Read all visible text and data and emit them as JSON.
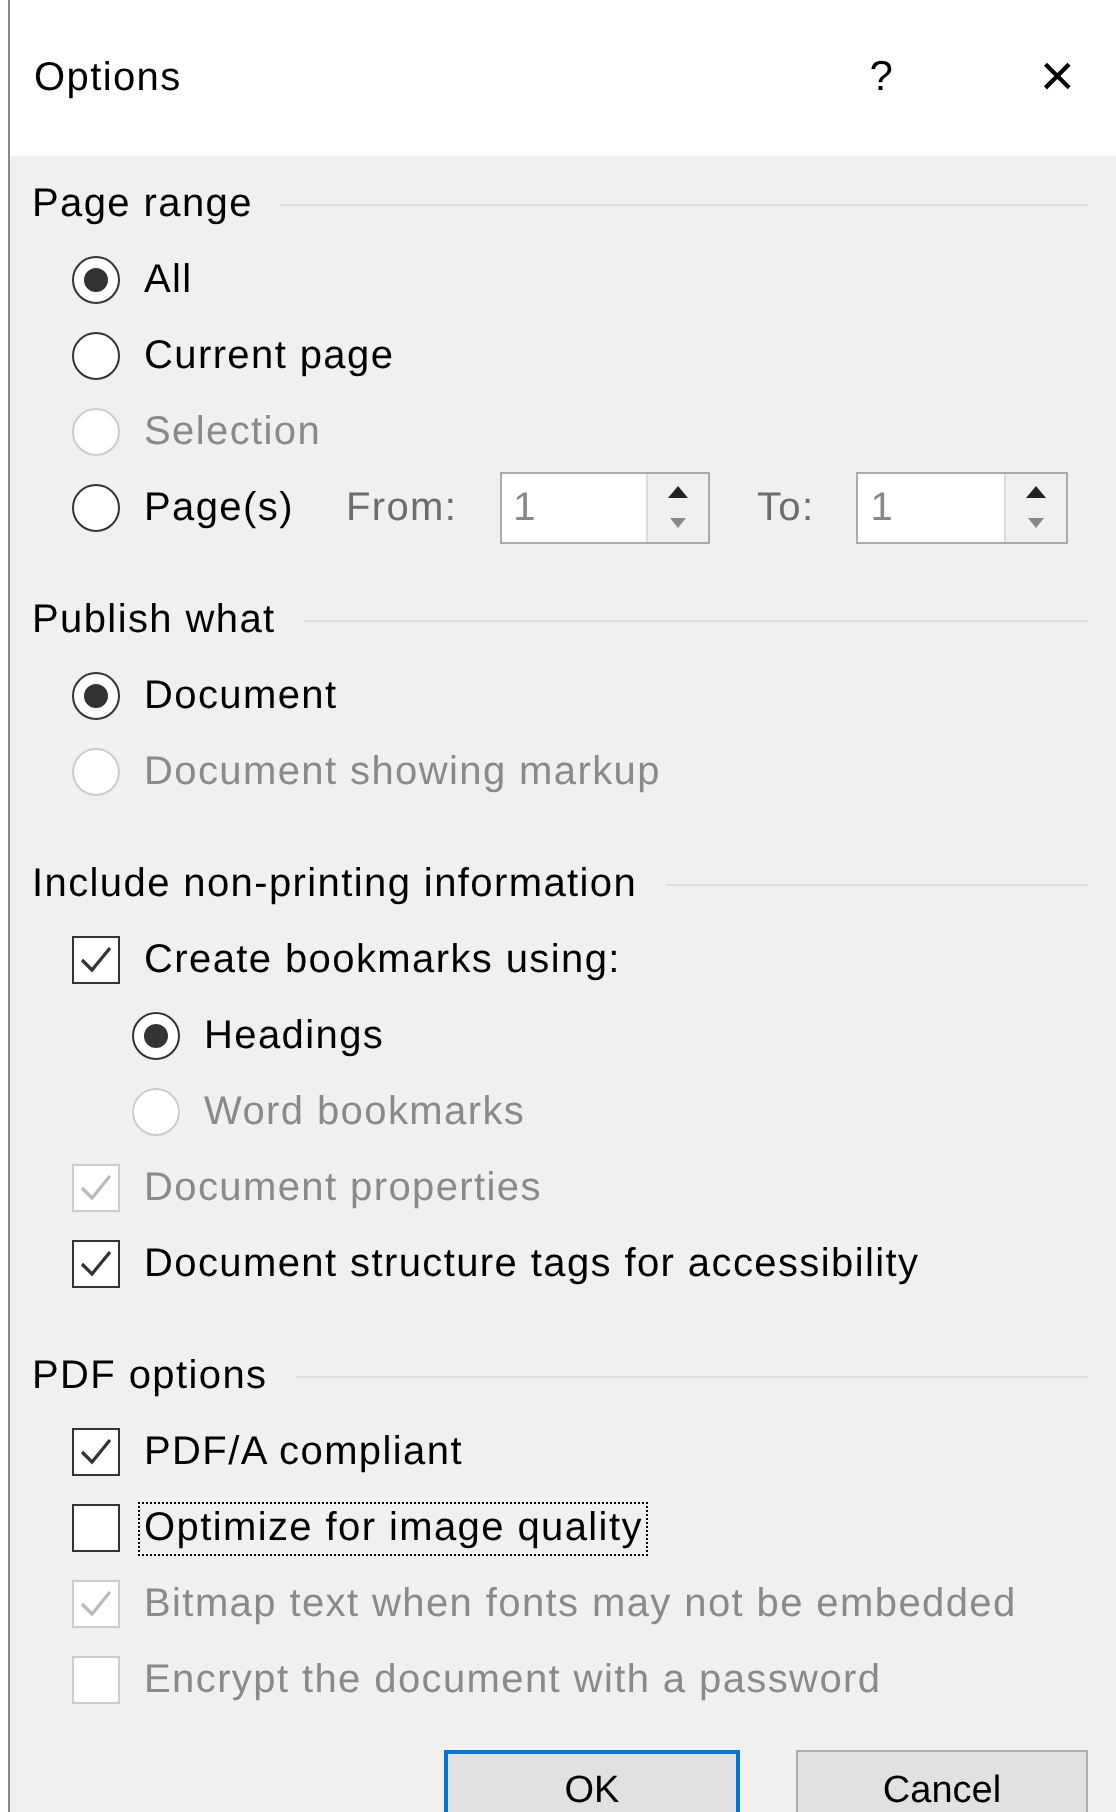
{
  "window": {
    "title": "Options",
    "help": "?",
    "close": "×"
  },
  "sections": [
    {
      "title": "Page range",
      "options": [
        {
          "kind": "radio",
          "label": "All",
          "selected": true,
          "disabled": false
        },
        {
          "kind": "radio",
          "label": "Current page",
          "selected": false,
          "disabled": false
        },
        {
          "kind": "radio",
          "label": "Selection",
          "selected": false,
          "disabled": true
        },
        {
          "kind": "radio",
          "label": "Page(s)",
          "selected": false,
          "disabled": false,
          "range": {
            "from_label": "From:",
            "from_value": "1",
            "to_label": "To:",
            "to_value": "1",
            "disabled": true
          }
        }
      ]
    },
    {
      "title": "Publish what",
      "options": [
        {
          "kind": "radio",
          "label": "Document",
          "selected": true,
          "disabled": false
        },
        {
          "kind": "radio",
          "label": "Document showing markup",
          "selected": false,
          "disabled": true
        }
      ]
    },
    {
      "title": "Include non-printing information",
      "options": [
        {
          "kind": "checkbox",
          "label": "Create bookmarks using:",
          "checked": true,
          "disabled": false,
          "children": [
            {
              "kind": "radio",
              "label": "Headings",
              "selected": true,
              "disabled": false
            },
            {
              "kind": "radio",
              "label": "Word bookmarks",
              "selected": false,
              "disabled": true
            }
          ]
        },
        {
          "kind": "checkbox",
          "label": "Document properties",
          "checked": true,
          "disabled": true
        },
        {
          "kind": "checkbox",
          "label": "Document structure tags for accessibility",
          "checked": true,
          "disabled": false
        }
      ]
    },
    {
      "title": "PDF options",
      "options": [
        {
          "kind": "checkbox",
          "label": "PDF/A compliant",
          "checked": true,
          "disabled": false
        },
        {
          "kind": "checkbox",
          "label": "Optimize for image quality",
          "checked": false,
          "disabled": false,
          "focused": true
        },
        {
          "kind": "checkbox",
          "label": "Bitmap text when fonts may not be embedded",
          "checked": true,
          "disabled": true
        },
        {
          "kind": "checkbox",
          "label": "Encrypt the document with a password",
          "checked": false,
          "disabled": true
        }
      ]
    }
  ],
  "buttons": [
    {
      "label": "OK",
      "default": true
    },
    {
      "label": "Cancel",
      "default": false
    }
  ]
}
